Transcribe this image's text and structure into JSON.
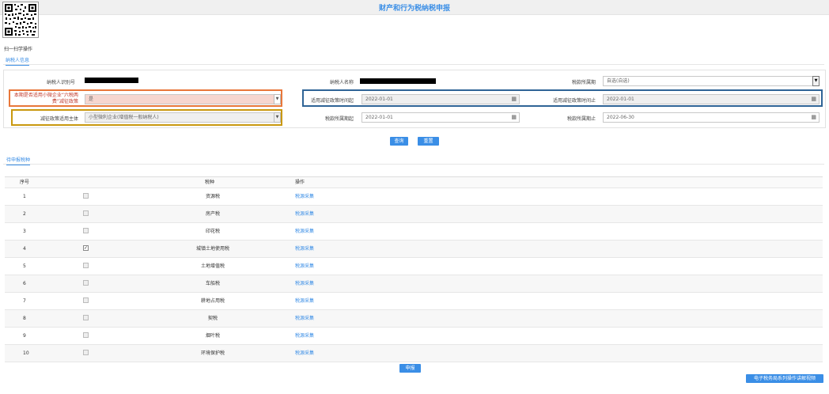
{
  "header": {
    "title": "财产和行为税纳税申报"
  },
  "qr": {
    "caption": "扫一扫学操作"
  },
  "tabs": {
    "taxpayer_info": "纳税人信息",
    "pending": "待申报税种"
  },
  "form": {
    "taxpayer_id_label": "纳税人识别号",
    "taxpayer_name_label": "纳税人名称",
    "tax_period_label": "税款所属期",
    "tax_period_value": "自选(自选)",
    "small_micro_label": "本期是否适用小微企业“六税两费”减征政策",
    "small_micro_value": "是",
    "reduction_start_label": "适用减征政策时间起",
    "reduction_start_value": "2022-01-01",
    "reduction_end_label": "适用减征政策时间止",
    "reduction_end_value": "2022-01-01",
    "reduction_subject_label": "减征政策适用主体",
    "reduction_subject_value": "小型微利企业(增值税一般纳税人)",
    "period_start_label": "税款所属期起",
    "period_start_value": "2022-01-01",
    "period_end_label": "税款所属期止",
    "period_end_value": "2022-06-30"
  },
  "buttons": {
    "query": "查询",
    "reset": "重置",
    "declare": "申报",
    "video": "电子税务局系列操作讲解视频"
  },
  "table": {
    "headers": [
      "序号",
      "",
      "税种",
      "操作"
    ],
    "rows": [
      {
        "no": "1",
        "tax": "资源税",
        "action": "税源采集",
        "checked": false
      },
      {
        "no": "2",
        "tax": "房产税",
        "action": "税源采集",
        "checked": false
      },
      {
        "no": "3",
        "tax": "印花税",
        "action": "税源采集",
        "checked": false
      },
      {
        "no": "4",
        "tax": "城镇土地使用税",
        "action": "税源采集",
        "checked": true
      },
      {
        "no": "5",
        "tax": "土地增值税",
        "action": "税源采集",
        "checked": false
      },
      {
        "no": "6",
        "tax": "车船税",
        "action": "税源采集",
        "checked": false
      },
      {
        "no": "7",
        "tax": "耕地占用税",
        "action": "税源采集",
        "checked": false
      },
      {
        "no": "8",
        "tax": "契税",
        "action": "税源采集",
        "checked": false
      },
      {
        "no": "9",
        "tax": "烟叶税",
        "action": "税源采集",
        "checked": false
      },
      {
        "no": "10",
        "tax": "环境保护税",
        "action": "税源采集",
        "checked": false
      }
    ]
  },
  "colors": {
    "accent": "#3a8ee6",
    "highlight_orange": "#e8773a",
    "highlight_blue": "#2f6496",
    "highlight_gold": "#c9980f"
  },
  "icons": {
    "calendar": "calendar-icon",
    "dropdown": "chevron-down-icon",
    "check": "check-icon"
  }
}
